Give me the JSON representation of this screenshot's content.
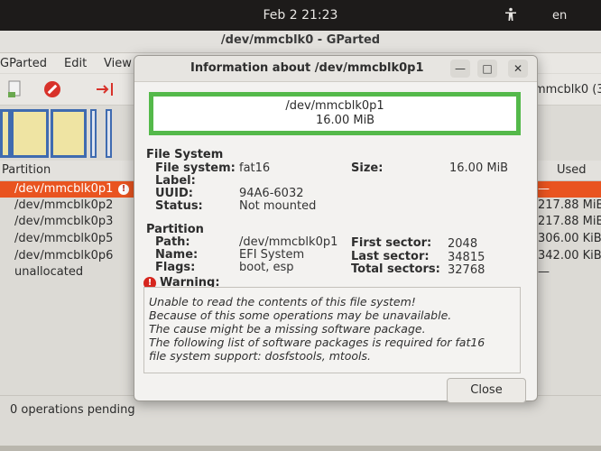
{
  "system": {
    "clock": "Feb 2  21:23",
    "lang": "en"
  },
  "main_window": {
    "title": "/dev/mmcblk0 - GParted",
    "menu": [
      "GParted",
      "Edit",
      "View"
    ],
    "device_selector": "mmcblk0 (3",
    "columns": {
      "partition": "Partition",
      "used": "Used"
    },
    "rows": [
      {
        "name": "/dev/mmcblk0p1",
        "used": "—"
      },
      {
        "name": "/dev/mmcblk0p2",
        "used": "217.88 MiB"
      },
      {
        "name": "/dev/mmcblk0p3",
        "used": "217.88 MiB"
      },
      {
        "name": "/dev/mmcblk0p5",
        "used": "306.00 KiB"
      },
      {
        "name": "/dev/mmcblk0p6",
        "used": "342.00 KiB"
      },
      {
        "name": "unallocated",
        "used": "—"
      }
    ],
    "status": "0 operations pending"
  },
  "dialog": {
    "title": "Information about /dev/mmcblk0p1",
    "graphic_line1": "/dev/mmcblk0p1",
    "graphic_line2": "16.00 MiB",
    "file_system_header": "File System",
    "fs_labels": {
      "file_system": "File system:",
      "label": "Label:",
      "uuid": "UUID:",
      "status": "Status:",
      "size": "Size:"
    },
    "fs_values": {
      "file_system": "fat16",
      "label": "",
      "uuid": "94A6-6032",
      "status": "Not mounted",
      "size": "16.00 MiB"
    },
    "partition_header": "Partition",
    "part_labels": {
      "path": "Path:",
      "name": "Name:",
      "flags": "Flags:",
      "first_sector": "First sector:",
      "last_sector": "Last sector:",
      "total_sectors": "Total sectors:"
    },
    "part_values": {
      "path": "/dev/mmcblk0p1",
      "name": "EFI System",
      "flags": "boot, esp",
      "first_sector": "2048",
      "last_sector": "34815",
      "total_sectors": "32768"
    },
    "warning_header": "Warning:",
    "warning_lines": [
      "Unable to read the contents of this file system!",
      "Because of this some operations may be unavailable.",
      "The cause might be a missing software package.",
      "The following list of software packages is required for fat16",
      "file system support:  dosfstools, mtools."
    ],
    "close_label": "Close"
  },
  "colors": {
    "selection": "#e95420",
    "graphic_border": "#54b94a",
    "partition_fill": "#efe4a3",
    "partition_border": "#3f6bb0",
    "error": "#d6261e"
  },
  "icons": [
    "accessibility-icon",
    "new-partition-icon",
    "delete-icon",
    "resize-move-icon",
    "error-icon",
    "warning-icon",
    "minimize-icon",
    "maximize-icon",
    "close-icon"
  ]
}
